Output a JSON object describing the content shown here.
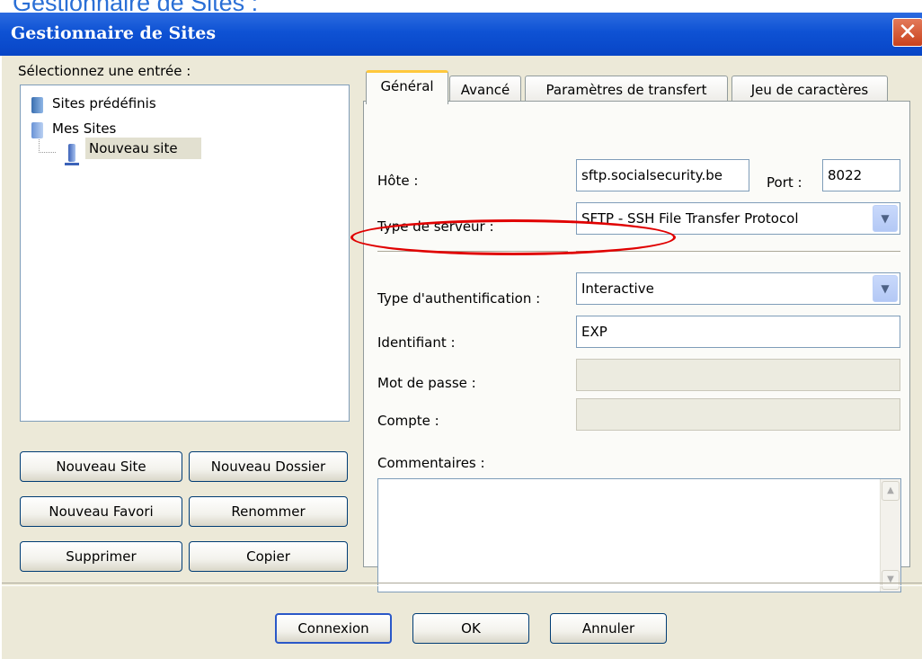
{
  "slide": {
    "title": "Gestionnaire de Sites :"
  },
  "window": {
    "title": "Gestionnaire de Sites",
    "close": "✕"
  },
  "left": {
    "select_label": "Sélectionnez une entrée :",
    "tree": [
      "Sites prédéfinis",
      "Mes Sites",
      "Nouveau site"
    ],
    "buttons": {
      "new_site": "Nouveau Site",
      "new_folder": "Nouveau Dossier",
      "new_bookmark": "Nouveau Favori",
      "rename": "Renommer",
      "delete": "Supprimer",
      "copy": "Copier"
    }
  },
  "tabs": [
    "Général",
    "Avancé",
    "Paramètres de transfert",
    "Jeu de caractères"
  ],
  "general": {
    "host_label": "Hôte :",
    "host_value": "sftp.socialsecurity.be",
    "port_label": "Port :",
    "port_value": "8022",
    "server_type_label": "Type de serveur :",
    "server_type_value": "SFTP - SSH File Transfer Protocol",
    "auth_label": "Type d'authentification :",
    "auth_value": "Interactive",
    "user_label": "Identifiant :",
    "user_value": "EXP",
    "password_label": "Mot de passe :",
    "account_label": "Compte :",
    "comments_label": "Commentaires :"
  },
  "footer": {
    "connect": "Connexion",
    "ok": "OK",
    "cancel": "Annuler"
  },
  "icons": {
    "select_arrow": "▼",
    "scroll_up": "▲",
    "scroll_down": "▼"
  },
  "annotation_color": "#e00000"
}
